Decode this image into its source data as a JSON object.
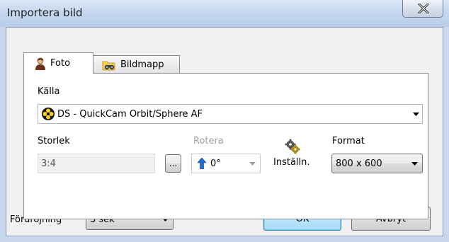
{
  "window": {
    "title": "Importera bild"
  },
  "tabs": [
    {
      "label": "Foto",
      "icon": "person-icon",
      "selected": true
    },
    {
      "label": "Bildmapp",
      "icon": "folder-binoculars-icon",
      "selected": false
    }
  ],
  "source": {
    "label": "Källa",
    "value": "DS - QuickCam Orbit/Sphere AF",
    "icon": "camera-source-icon"
  },
  "size": {
    "label": "Storlek",
    "value": "3:4",
    "browse_label": "..."
  },
  "rotate": {
    "label": "Rotera",
    "value": "0°",
    "enabled": false
  },
  "settings": {
    "label": "Inställn.",
    "icon": "gears-icon"
  },
  "format": {
    "label": "Format",
    "value": "800 x 600"
  },
  "delay": {
    "label": "Fördröjning",
    "value": "3 sek"
  },
  "buttons": {
    "ok": "OK",
    "cancel": "Avbryt"
  },
  "colors": {
    "titlebar": "#c5d7ee",
    "dialog_bg": "#f0f0f0",
    "default_button": "#bee6fd",
    "rotate_arrow": "#1d6fd1"
  }
}
